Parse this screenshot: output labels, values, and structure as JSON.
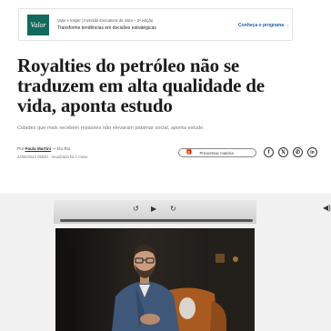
{
  "ad": {
    "logo_text": "Valor",
    "line1": "Valor e Insper | Inversão Executivos de Valor – 2ª edição",
    "line2": "Transforme tendências em decisões estratégicas",
    "cta": "Conheça o programa →"
  },
  "article": {
    "headline": "Royalties do petróleo não se traduzem em alta qualidade de vida, aponta estudo",
    "subtitle": "Cidades que mais recebem repasses não elevaram patamar social, aponta estudo",
    "byline_prefix": "Por",
    "author": "Paula Martini",
    "location": "— Do Rio",
    "date": "24/06/2024 05h00 · Atualizado há 1 mese",
    "present_label": "Presentear matéria"
  },
  "share": {
    "icons": [
      "facebook-icon",
      "x-icon",
      "whatsapp-icon",
      "linkedin-icon"
    ],
    "glyphs": [
      "f",
      "𝕏",
      "✆",
      "in"
    ]
  },
  "player": {
    "rewind_glyph": "↺",
    "play_glyph": "▶",
    "forward_glyph": "↻",
    "volume_glyph": "◀)"
  },
  "colors": {
    "brand": "#136a5c",
    "link": "#1a5fb0"
  }
}
